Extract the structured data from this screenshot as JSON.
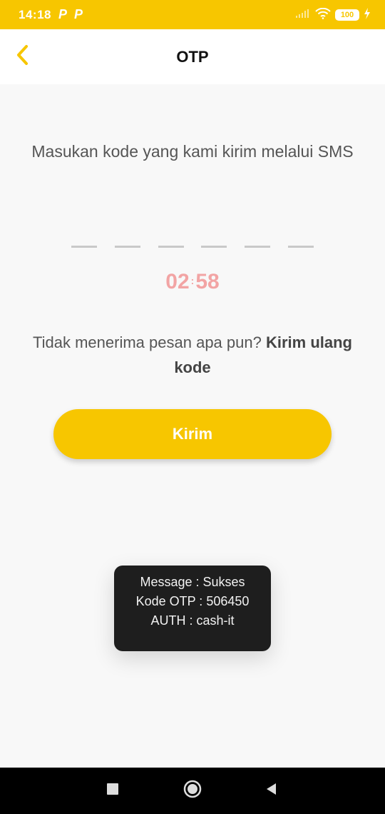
{
  "status_bar": {
    "time": "14:18",
    "notification_icons": [
      "P",
      "P"
    ],
    "battery": "100"
  },
  "header": {
    "title": "OTP"
  },
  "main": {
    "instruction": "Masukan kode yang kami kirim melalui SMS",
    "otp_slots": 6,
    "timer": {
      "minutes": "02",
      "seconds": "58"
    },
    "resend_prefix": "Tidak menerima pesan apa pun?",
    "resend_link": "Kirim ulang kode",
    "submit_label": "Kirim"
  },
  "toast": {
    "line1": "Message : Sukses",
    "line2": "Kode OTP : 506450",
    "line3": "AUTH : cash-it"
  },
  "colors": {
    "accent": "#f7c600",
    "timer": "#f2a4a4",
    "toast_bg": "#1e1e1e"
  }
}
